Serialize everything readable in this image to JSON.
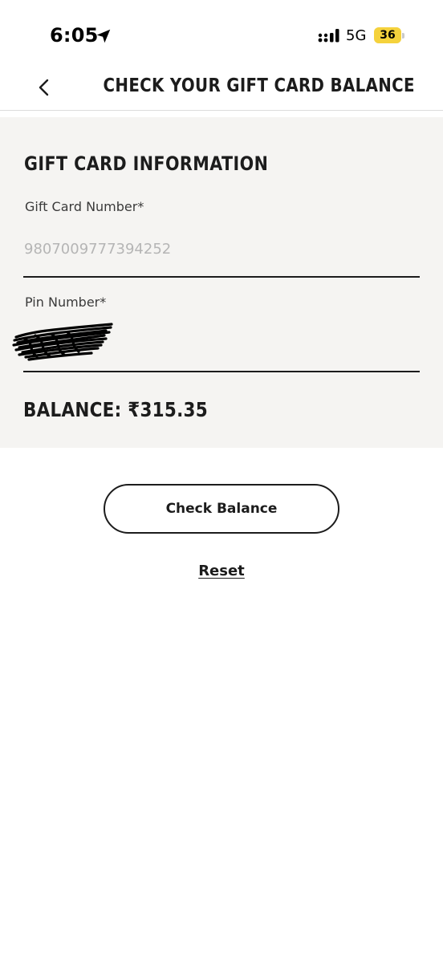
{
  "status_bar": {
    "time": "6:05",
    "location_icon": "location-arrow-icon",
    "signal_icon": "cellular-signal-icon",
    "network": "5G",
    "battery_level": "36",
    "battery_fraction": 0.36,
    "battery_color": "#f5d23c"
  },
  "header": {
    "back_icon": "chevron-left-icon",
    "title": "CHECK YOUR GIFT CARD BALANCE"
  },
  "gift_card_info": {
    "section_title": "GIFT CARD INFORMATION",
    "card_number": {
      "label": "Gift Card Number*",
      "value": "9807009777394252"
    },
    "pin_number": {
      "label": "Pin Number*",
      "value_redacted": true
    },
    "balance_label": "BALANCE:",
    "balance_value": "₹315.35"
  },
  "actions": {
    "check_balance_label": "Check Balance",
    "reset_label": "Reset"
  },
  "colors": {
    "panel_background": "#f5f4f2",
    "text_primary": "#1c1c1c",
    "placeholder_text": "#b5b5b5"
  }
}
